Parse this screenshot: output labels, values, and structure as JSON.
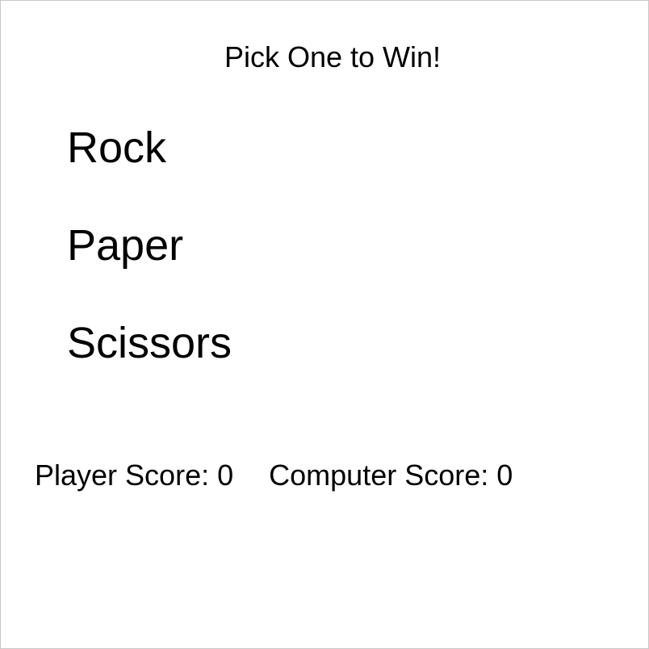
{
  "prompt": "Pick One to Win!",
  "choices": [
    {
      "label": "Rock"
    },
    {
      "label": "Paper"
    },
    {
      "label": "Scissors"
    }
  ],
  "scores": {
    "player": "Player Score: 0",
    "computer": "Computer Score: 0"
  }
}
